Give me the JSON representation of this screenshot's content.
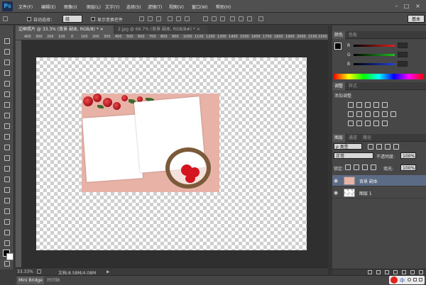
{
  "app": {
    "logo": "Ps"
  },
  "menu": [
    "文件(F)",
    "编辑(E)",
    "图像(I)",
    "图层(L)",
    "文字(Y)",
    "选择(S)",
    "滤镜(T)",
    "视图(V)",
    "窗口(W)",
    "帮助(H)"
  ],
  "window_controls": {
    "minimize": "–",
    "restore": "□",
    "close": "×"
  },
  "options": {
    "auto_select_label": "自动选择：",
    "auto_select_value": "组",
    "show_transform_label": "显示变换控件",
    "workspace": "基本"
  },
  "tabs": [
    {
      "label": "边框照片 @ 33.3% (背景 副本, RGB/8) *",
      "close": "×"
    },
    {
      "label": "2.jpg @ 66.7% (背景 副本, RGB/8#) *",
      "close": "×"
    }
  ],
  "ruler_ticks": [
    "400",
    "300",
    "200",
    "100",
    "0",
    "100",
    "200",
    "300",
    "400",
    "500",
    "600",
    "700",
    "800",
    "900",
    "1000",
    "1100",
    "1200",
    "1300",
    "1400",
    "1500",
    "1600",
    "1700",
    "1800",
    "1900",
    "2000",
    "2100",
    "2200"
  ],
  "status": {
    "zoom": "33.33%",
    "doc_size": "文档:8.58M/4.08M"
  },
  "bottom": {
    "mini_bridge": "Mini Bridge",
    "timeline": "时间轴"
  },
  "color_panel": {
    "tabs": [
      "颜色",
      "色板"
    ],
    "channels": [
      {
        "label": "R",
        "value": "0",
        "color": "#e02020"
      },
      {
        "label": "G",
        "value": "0",
        "color": "#20c020"
      },
      {
        "label": "B",
        "value": "0",
        "color": "#2040e0"
      }
    ]
  },
  "adjust_panel": {
    "tabs": [
      "调整",
      "样式"
    ],
    "title": "添加调整"
  },
  "layers_panel": {
    "tabs": [
      "图层",
      "通道",
      "路径"
    ],
    "filter_kind": "ρ 类型",
    "blend_mode": "正常",
    "opacity_label": "不透明度:",
    "opacity_value": "100%",
    "lock_label": "锁定:",
    "fill_label": "填充:",
    "fill_value": "100%",
    "layers": [
      {
        "name": "背景 副本",
        "selected": true
      },
      {
        "name": "图层 1",
        "selected": false
      }
    ]
  },
  "ime": {
    "label": "中"
  }
}
